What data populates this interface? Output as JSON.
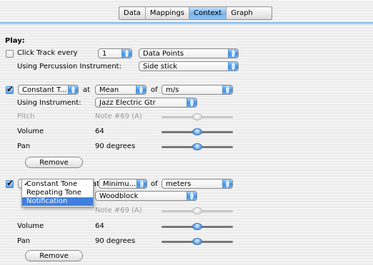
{
  "tabs": [
    {
      "label": "Data",
      "active": false
    },
    {
      "label": "Mappings",
      "active": false
    },
    {
      "label": "Context",
      "active": true
    },
    {
      "label": "Graph",
      "active": false
    }
  ],
  "play": {
    "heading": "Play:",
    "click_track_label": "Click Track every",
    "click_track_value": "1",
    "data_points_value": "Data Points",
    "percussion_label": "Using Percussion Instrument:",
    "percussion_value": "Side stick"
  },
  "section1": {
    "enabled": true,
    "type_value": "Constant T...",
    "at_label": "at",
    "stat_value": "Mean",
    "of_label": "of",
    "unit_value": "m/s",
    "instrument_label": "Using Instrument:",
    "instrument_value": "Jazz Electric Gtr",
    "pitch_label": "Pitch",
    "pitch_value": "Note #69 (A)",
    "volume_label": "Volume",
    "volume_value": "64",
    "pan_label": "Pan",
    "pan_value": "90 degrees",
    "remove_label": "Remove",
    "pitch_level": 0.5,
    "volume_level": 0.5,
    "pan_level": 0.5
  },
  "section2": {
    "enabled": true,
    "at_label": "at",
    "stat_value": "Minimu...",
    "of_label": "of",
    "unit_value": "meters",
    "instrument_value": "Woodblock",
    "pitch_value": "Note #69 (A)",
    "volume_label": "Volume",
    "volume_value": "64",
    "pan_label": "Pan",
    "pan_value": "90 degrees",
    "remove_label": "Remove",
    "pitch_level": 0.5,
    "volume_level": 0.5,
    "pan_level": 0.5
  },
  "type_menu": {
    "items": [
      {
        "label": "Constant Tone",
        "checked": true,
        "highlighted": false
      },
      {
        "label": "Repeating Tone",
        "checked": false,
        "highlighted": false
      },
      {
        "label": "Notification",
        "checked": false,
        "highlighted": true
      }
    ]
  },
  "colors": {
    "accent": "#5aa0ea",
    "tab_active": "#73b3ee",
    "menu_highlight": "#3d80df"
  }
}
